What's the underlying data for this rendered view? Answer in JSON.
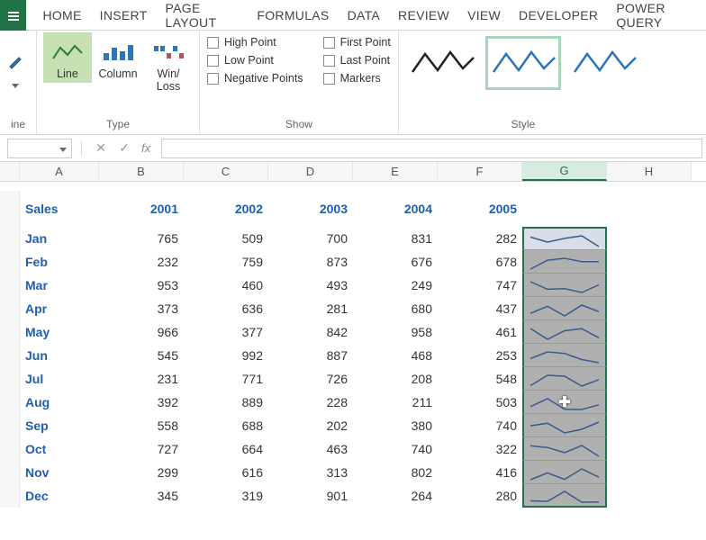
{
  "ribbon": {
    "tabs": [
      "HOME",
      "INSERT",
      "PAGE LAYOUT",
      "FORMULAS",
      "DATA",
      "REVIEW",
      "VIEW",
      "DEVELOPER",
      "POWER QUERY"
    ],
    "groups": {
      "sparkline_label": "ine",
      "type": {
        "label": "Type",
        "buttons": [
          {
            "label": "Line",
            "selected": true
          },
          {
            "label": "Column",
            "selected": false
          },
          {
            "label": "Win/\nLoss",
            "selected": false
          }
        ]
      },
      "show": {
        "label": "Show",
        "options": [
          {
            "label": "High Point"
          },
          {
            "label": "First Point"
          },
          {
            "label": "Low Point"
          },
          {
            "label": "Last Point"
          },
          {
            "label": "Negative Points"
          },
          {
            "label": "Markers"
          }
        ]
      },
      "style": {
        "label": "Style"
      }
    }
  },
  "formula_bar": {
    "name_box": "",
    "fx_label": "fx",
    "value": ""
  },
  "grid": {
    "column_headers": [
      "A",
      "B",
      "C",
      "D",
      "E",
      "F",
      "G",
      "H"
    ],
    "active_column": "G",
    "title": "Sales",
    "year_headers": [
      "2001",
      "2002",
      "2003",
      "2004",
      "2005"
    ],
    "rows": [
      {
        "month": "Jan",
        "vals": [
          765,
          509,
          700,
          831,
          282
        ]
      },
      {
        "month": "Feb",
        "vals": [
          232,
          759,
          873,
          676,
          678
        ]
      },
      {
        "month": "Mar",
        "vals": [
          953,
          460,
          493,
          249,
          747
        ]
      },
      {
        "month": "Apr",
        "vals": [
          373,
          636,
          281,
          680,
          437
        ]
      },
      {
        "month": "May",
        "vals": [
          966,
          377,
          842,
          958,
          461
        ]
      },
      {
        "month": "Jun",
        "vals": [
          545,
          992,
          887,
          468,
          253
        ]
      },
      {
        "month": "Jul",
        "vals": [
          231,
          771,
          726,
          208,
          548
        ]
      },
      {
        "month": "Aug",
        "vals": [
          392,
          889,
          228,
          211,
          503
        ]
      },
      {
        "month": "Sep",
        "vals": [
          558,
          688,
          202,
          380,
          740
        ]
      },
      {
        "month": "Oct",
        "vals": [
          727,
          664,
          463,
          740,
          322
        ]
      },
      {
        "month": "Nov",
        "vals": [
          299,
          616,
          313,
          802,
          416
        ]
      },
      {
        "month": "Dec",
        "vals": [
          345,
          319,
          901,
          264,
          280
        ]
      }
    ]
  },
  "chart_data": {
    "type": "line",
    "title": "Sales sparklines by month (2001–2005)",
    "x": [
      2001,
      2002,
      2003,
      2004,
      2005
    ],
    "series": [
      {
        "name": "Jan",
        "values": [
          765,
          509,
          700,
          831,
          282
        ]
      },
      {
        "name": "Feb",
        "values": [
          232,
          759,
          873,
          676,
          678
        ]
      },
      {
        "name": "Mar",
        "values": [
          953,
          460,
          493,
          249,
          747
        ]
      },
      {
        "name": "Apr",
        "values": [
          373,
          636,
          281,
          680,
          437
        ]
      },
      {
        "name": "May",
        "values": [
          966,
          377,
          842,
          958,
          461
        ]
      },
      {
        "name": "Jun",
        "values": [
          545,
          992,
          887,
          468,
          253
        ]
      },
      {
        "name": "Jul",
        "values": [
          231,
          771,
          726,
          208,
          548
        ]
      },
      {
        "name": "Aug",
        "values": [
          392,
          889,
          228,
          211,
          503
        ]
      },
      {
        "name": "Sep",
        "values": [
          558,
          688,
          202,
          380,
          740
        ]
      },
      {
        "name": "Oct",
        "values": [
          727,
          664,
          463,
          740,
          322
        ]
      },
      {
        "name": "Nov",
        "values": [
          299,
          616,
          313,
          802,
          416
        ]
      },
      {
        "name": "Dec",
        "values": [
          345,
          319,
          901,
          264,
          280
        ]
      }
    ],
    "ylim": [
      0,
      1000
    ]
  }
}
